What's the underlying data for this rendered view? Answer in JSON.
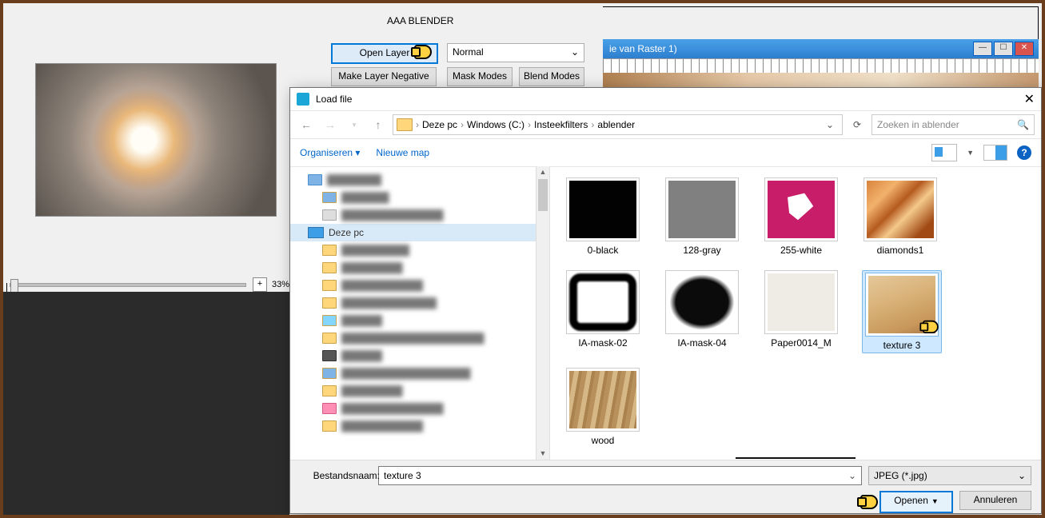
{
  "plugin": {
    "title": "AAA BLENDER",
    "open_layer": "Open Layer",
    "make_negative": "Make Layer Negative",
    "mask_modes": "Mask Modes",
    "blend_modes": "Blend Modes",
    "mode_select": "Normal",
    "zoom": "33%"
  },
  "bgwin": {
    "title_fragment": "ie van Raster 1)"
  },
  "dialog": {
    "title": "Load file",
    "crumbs": [
      "Deze pc",
      "Windows (C:)",
      "Insteekfilters",
      "ablender"
    ],
    "search_placeholder": "Zoeken in ablender",
    "organize": "Organiseren",
    "new_folder": "Nieuwe map",
    "tree": {
      "selected": "Deze pc"
    },
    "files": [
      {
        "name": "0-black",
        "k": "t-black"
      },
      {
        "name": "128-gray",
        "k": "t-gray"
      },
      {
        "name": "255-white",
        "k": "t-white"
      },
      {
        "name": "diamonds1",
        "k": "t-diamonds"
      },
      {
        "name": "IA-mask-02",
        "k": "t-iamask02"
      },
      {
        "name": "IA-mask-04",
        "k": "t-iamask04"
      },
      {
        "name": "Paper0014_M",
        "k": "t-paper"
      },
      {
        "name": "texture 3",
        "k": "t-texture3",
        "selected": true
      },
      {
        "name": "wood",
        "k": "t-wood"
      }
    ],
    "filename_label": "Bestandsnaam:",
    "filename_value": "texture 3",
    "filetype": "JPEG (*.jpg)",
    "open": "Openen",
    "cancel": "Annuleren"
  }
}
